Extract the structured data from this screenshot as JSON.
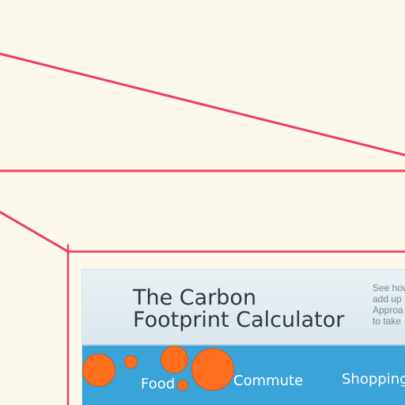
{
  "frame": {
    "accent_color": "#ee3d5b"
  },
  "calculator": {
    "title": "The Carbon\nFootprint Calculator",
    "intro_text": "See how\nadd up\nApproa\nto take",
    "bubble_color": "#ff6f1e",
    "screen_color": "#3aa3d8",
    "tabs": [
      {
        "label": "Food"
      },
      {
        "label": "Commute"
      },
      {
        "label": "Shopping"
      }
    ]
  }
}
